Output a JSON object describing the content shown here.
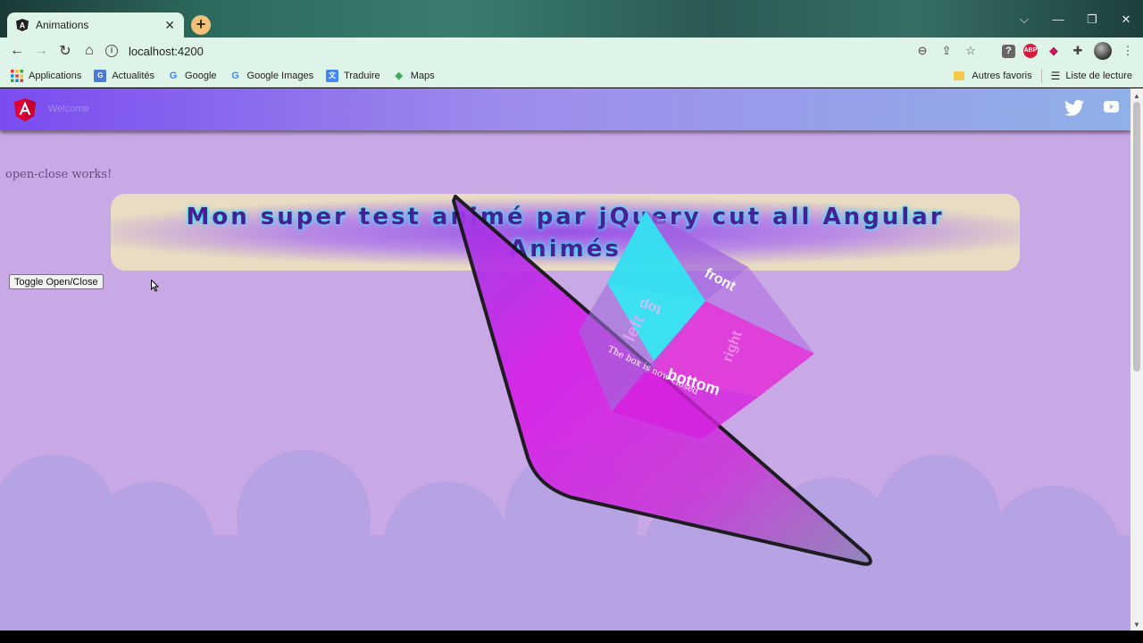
{
  "browser": {
    "tab_title": "Animations",
    "tab_close": "✕",
    "new_tab": "+",
    "url": "localhost:4200",
    "window_controls": {
      "dropdown": "⌵",
      "minimize": "—",
      "restore": "❐",
      "close": "✕"
    }
  },
  "toolbar_icons": [
    "zoom-icon",
    "share-icon",
    "star-icon",
    "help-extension-icon",
    "adblock-plus-icon",
    "pocket-extension-icon",
    "extensions-puzzle-icon",
    "profile-avatar",
    "menu-kebab-icon"
  ],
  "bookmarks": {
    "items": [
      {
        "label": "Applications",
        "icon": "apps-grid-icon"
      },
      {
        "label": "Actualités",
        "icon": "news-icon"
      },
      {
        "label": "Google",
        "icon": "google-icon"
      },
      {
        "label": "Google Images",
        "icon": "google-icon"
      },
      {
        "label": "Traduire",
        "icon": "translate-icon"
      },
      {
        "label": "Maps",
        "icon": "maps-icon"
      }
    ],
    "other_favorites": "Autres favoris",
    "reading_list": "Liste de lecture"
  },
  "app": {
    "header": {
      "welcome": "Welcome"
    },
    "status_text": "open-close works!",
    "toggle_button": "Toggle Open/Close",
    "banner_title_line1": "Mon super test animé par jQuery cut all Angular",
    "banner_title_line2": "Animés",
    "cube_faces": {
      "front": "front",
      "top": "top",
      "left": "left",
      "bottom": "bottom",
      "right": "right"
    },
    "cube_caption": "The box is now closed"
  },
  "colors": {
    "header_start": "#7a4cf0",
    "header_end": "#90b0e8",
    "page_background": "#c9a8e6",
    "cloud": "#b39fe0",
    "banner_text": "#4a1f94",
    "banner_glow": "#29f0ff",
    "diamond_magenta": "#d81ee8",
    "cube_cyan": "#2fe6f2",
    "cube_pink": "#e22ed6"
  }
}
